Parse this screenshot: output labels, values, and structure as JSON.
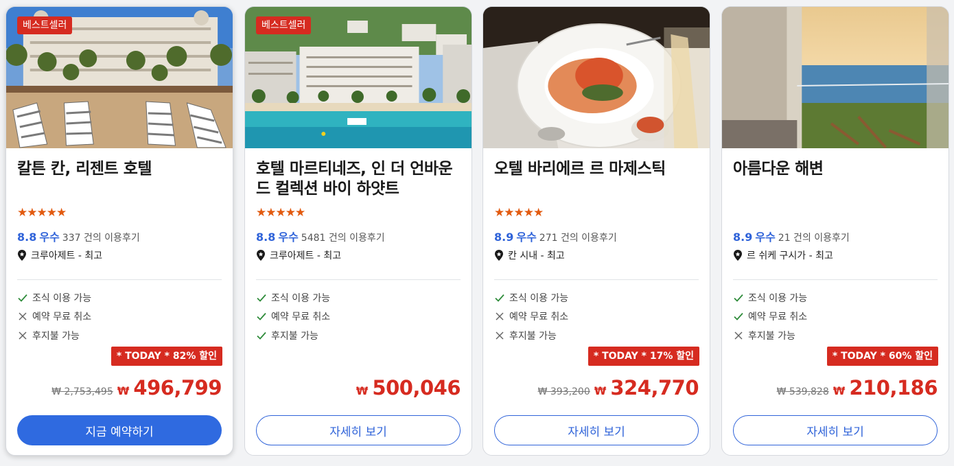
{
  "cards": [
    {
      "badge": "베스트셀러",
      "name": "칼튼 칸, 리젠트 호텔",
      "stars": "★★★★★",
      "score": "8.8",
      "score_word": "우수",
      "reviews": "337 건의 이용후기",
      "location": "크루아제트 - 최고",
      "features": [
        {
          "label": "조식 이용 가능",
          "available": true,
          "icon": "check-icon"
        },
        {
          "label": "예약 무료 취소",
          "available": false,
          "icon": "x-icon"
        },
        {
          "label": "후지불 가능",
          "available": false,
          "icon": "x-icon"
        }
      ],
      "discount_tag": "* TODAY * 82% 할인",
      "old_price": "₩ 2,753,495",
      "currency": "₩",
      "price": "496,799",
      "button": "지금 예약하기"
    },
    {
      "badge": "베스트셀러",
      "name": "호텔 마르티네즈, 인 더 언바운드 컬렉션 바이 하얏트",
      "stars": "★★★★★",
      "score": "8.8",
      "score_word": "우수",
      "reviews": "5481 건의 이용후기",
      "location": "크루아제트 - 최고",
      "features": [
        {
          "label": "조식 이용 가능",
          "available": true,
          "icon": "check-icon"
        },
        {
          "label": "예약 무료 취소",
          "available": true,
          "icon": "check-icon"
        },
        {
          "label": "후지불 가능",
          "available": true,
          "icon": "check-icon"
        }
      ],
      "discount_tag": "",
      "old_price": "",
      "currency": "₩",
      "price": "500,046",
      "button": "자세히 보기"
    },
    {
      "badge": "",
      "name": "오텔 바리에르 르 마제스틱",
      "stars": "★★★★★",
      "score": "8.9",
      "score_word": "우수",
      "reviews": "271 건의 이용후기",
      "location": "칸 시내 - 최고",
      "features": [
        {
          "label": "조식 이용 가능",
          "available": true,
          "icon": "check-icon"
        },
        {
          "label": "예약 무료 취소",
          "available": false,
          "icon": "x-icon"
        },
        {
          "label": "후지불 가능",
          "available": false,
          "icon": "x-icon"
        }
      ],
      "discount_tag": "* TODAY * 17% 할인",
      "old_price": "₩ 393,200",
      "currency": "₩",
      "price": "324,770",
      "button": "자세히 보기"
    },
    {
      "badge": "",
      "name": "아름다운 해변",
      "stars": "",
      "score": "8.9",
      "score_word": "우수",
      "reviews": "21 건의 이용후기",
      "location": "르 쉬케 구시가 - 최고",
      "features": [
        {
          "label": "조식 이용 가능",
          "available": true,
          "icon": "check-icon"
        },
        {
          "label": "예약 무료 취소",
          "available": true,
          "icon": "check-icon"
        },
        {
          "label": "후지불 가능",
          "available": false,
          "icon": "x-icon"
        }
      ],
      "discount_tag": "* TODAY * 60% 할인",
      "old_price": "₩ 539,828",
      "currency": "₩",
      "price": "210,186",
      "button": "자세히 보기"
    }
  ],
  "colors": {
    "accent": "#2f6ae0",
    "sale": "#d62b20",
    "star": "#e25a0f",
    "check": "#2e8b3a"
  }
}
